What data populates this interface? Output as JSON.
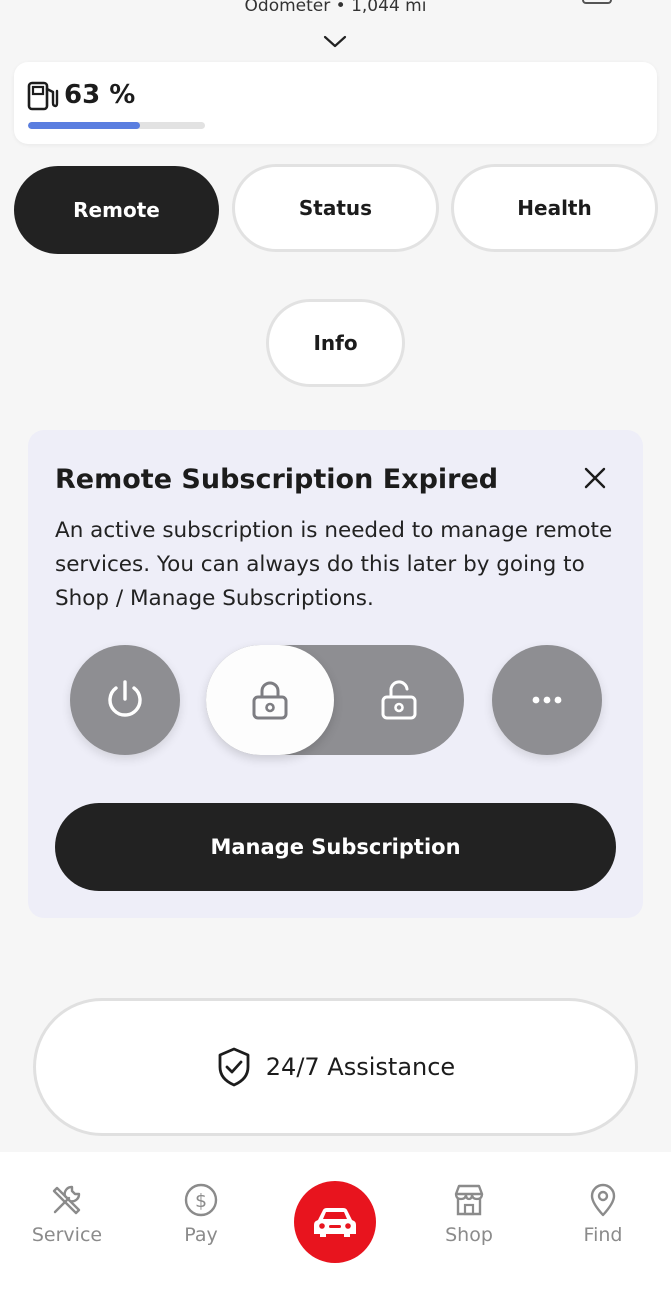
{
  "header": {
    "odometer_text": "Odometer • 1,044 mi"
  },
  "fuel": {
    "percent_text": "63 %",
    "level": 0.63,
    "bar_color": "#5a7ee0"
  },
  "tabs": [
    {
      "label": "Remote",
      "active": true
    },
    {
      "label": "Status",
      "active": false
    },
    {
      "label": "Health",
      "active": false
    },
    {
      "label": "Info",
      "active": false
    }
  ],
  "subscription_card": {
    "title": "Remote Subscription Expired",
    "body": "An active subscription is needed to manage remote services. You can always do this later by going to Shop / Manage Subscriptions.",
    "controls": {
      "power_icon": "power-icon",
      "lock_icon": "lock-icon",
      "unlock_icon": "unlock-icon",
      "more_icon": "more-icon"
    },
    "manage_label": "Manage Subscription"
  },
  "assistance": {
    "label": "24/7 Assistance",
    "icon": "shield-check-icon"
  },
  "bottom_nav": {
    "items": [
      {
        "label": "Service",
        "icon": "tools-icon"
      },
      {
        "label": "Pay",
        "icon": "dollar-icon"
      },
      {
        "label": "",
        "icon": "car-icon"
      },
      {
        "label": "Shop",
        "icon": "store-icon"
      },
      {
        "label": "Find",
        "icon": "location-pin-icon"
      }
    ]
  },
  "colors": {
    "accent_red": "#e8141e",
    "dark": "#222222",
    "card_background": "#eeeef8"
  }
}
